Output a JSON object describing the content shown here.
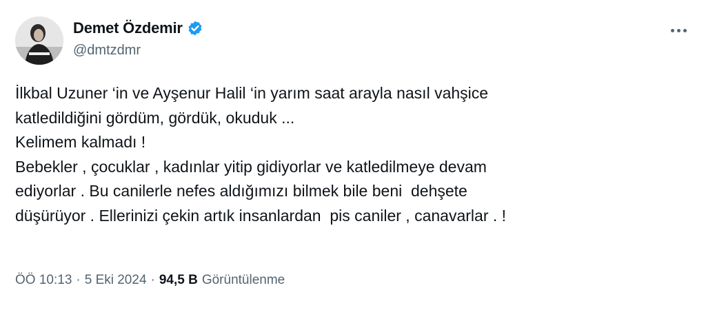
{
  "author": {
    "display_name": "Demet Özdemir",
    "handle": "@dmtzdmr",
    "verified": true,
    "verified_color": "#1d9bf0"
  },
  "tweet": {
    "lines": [
      "İlkbal Uzuner ‘in ve Ayşenur Halil ‘in yarım saat arayla nasıl vahşice",
      "katledildiğini gördüm, gördük, okuduk ...",
      "Kelimem kalmadı !",
      "Bebekler , çocuklar , kadınlar yitip gidiyorlar ve katledilmeye devam",
      "ediyorlar . Bu canilerle nefes aldığımızı bilmek bile beni  dehşete",
      "düşürüyor . Ellerinizi çekin artık insanlardan  pis caniler , canavarlar . !"
    ]
  },
  "meta": {
    "time": "ÖÖ 10:13",
    "separator": "·",
    "date": "5 Eki 2024",
    "views_count": "94,5 B",
    "views_label": "Görüntülenme"
  },
  "icons": {
    "more": "more-horizontal-icon",
    "verified": "verified-badge-icon"
  },
  "colors": {
    "text_primary": "#0f1419",
    "text_secondary": "#536471"
  }
}
